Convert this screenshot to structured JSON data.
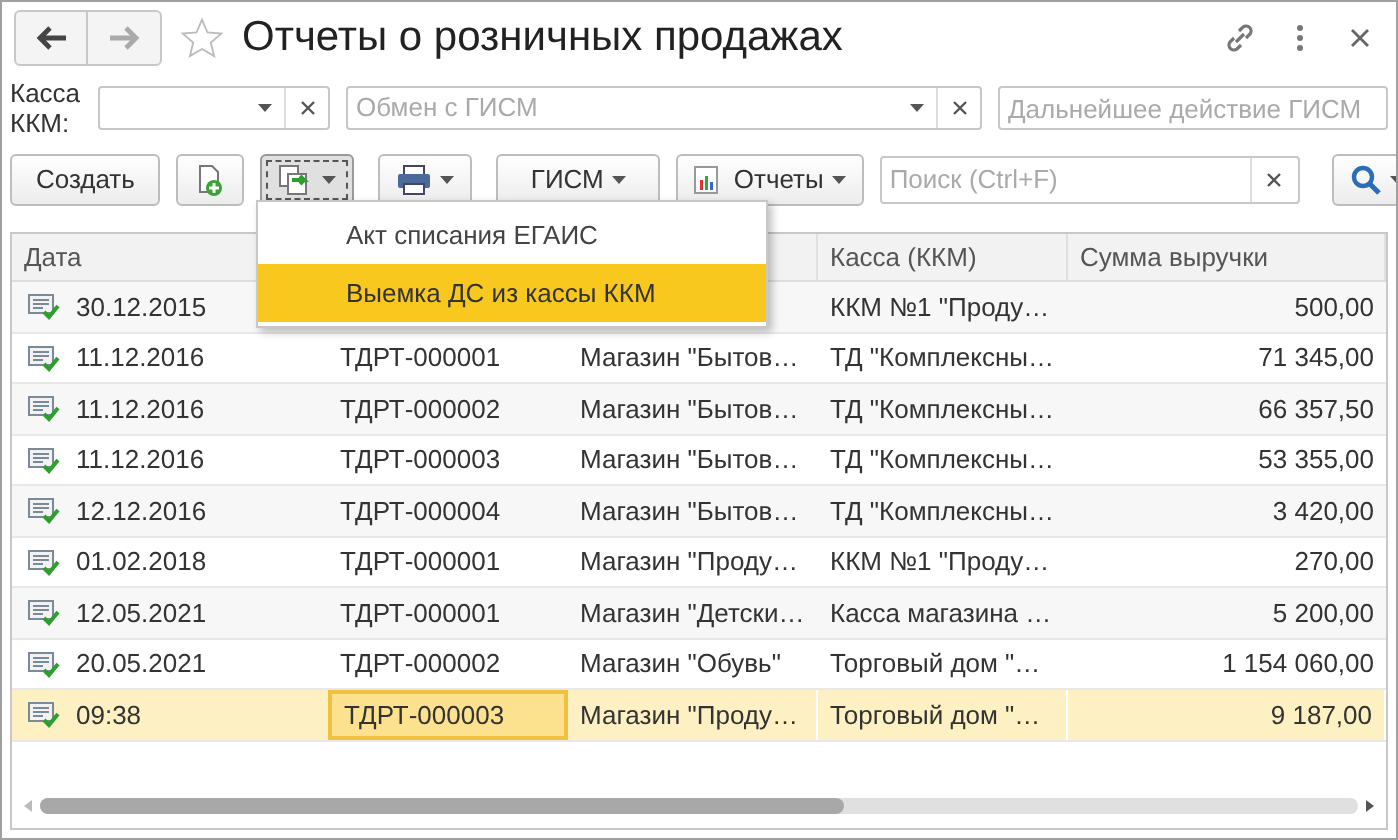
{
  "window": {
    "title": "Отчеты о розничных продажах",
    "favorite": false
  },
  "filters": {
    "register_label": "Касса ККМ:",
    "exchange_placeholder": "Обмен с ГИСМ",
    "next_action_placeholder": "Дальнейшее действие ГИСМ"
  },
  "toolbar": {
    "create": "Создать",
    "create_based_on_open": true,
    "gism": "ГИСМ",
    "reports": "Отчеты",
    "search_placeholder": "Поиск (Ctrl+F)"
  },
  "menu": [
    {
      "label": "Акт списания ЕГАИС",
      "selected": false
    },
    {
      "label": "Выемка ДС из кассы ККМ",
      "selected": true
    }
  ],
  "table": {
    "columns": [
      {
        "label": "Дата"
      },
      {},
      {},
      {
        "label": "Касса (ККМ)"
      },
      {
        "label": "Сумма выручки"
      }
    ],
    "rows": [
      {
        "date": "30.12.2015",
        "register": "ККМ №1 \"Проду…",
        "amount": "500,00",
        "selected": false
      },
      {
        "date": "11.12.2016",
        "number": "ТДРТ-000001",
        "shop": "Магазин \"Бытов…",
        "register": "ТД \"Комплексны…",
        "amount": "71 345,00",
        "selected": false
      },
      {
        "date": "11.12.2016",
        "number": "ТДРТ-000002",
        "shop": "Магазин \"Бытов…",
        "register": "ТД \"Комплексны…",
        "amount": "66 357,50",
        "selected": false
      },
      {
        "date": "11.12.2016",
        "number": "ТДРТ-000003",
        "shop": "Магазин \"Бытов…",
        "register": "ТД \"Комплексны…",
        "amount": "53 355,00",
        "selected": false
      },
      {
        "date": "12.12.2016",
        "number": "ТДРТ-000004",
        "shop": "Магазин \"Бытов…",
        "register": "ТД \"Комплексны…",
        "amount": "3 420,00",
        "selected": false
      },
      {
        "date": "01.02.2018",
        "number": "ТДРТ-000001",
        "shop": "Магазин \"Проду…",
        "register": "ККМ №1 \"Проду…",
        "amount": "270,00",
        "selected": false
      },
      {
        "date": "12.05.2021",
        "number": "ТДРТ-000001",
        "shop": "Магазин \"Детски…",
        "register": "Касса магазина …",
        "amount": "5 200,00",
        "selected": false
      },
      {
        "date": "20.05.2021",
        "number": "ТДРТ-000002",
        "shop": "Магазин \"Обувь\"",
        "register": "Торговый дом \"…",
        "amount": "1 154 060,00",
        "selected": false
      },
      {
        "date": "09:38",
        "number": "ТДРТ-000003",
        "shop": "Магазин \"Проду…",
        "register": "Торговый дом \"…",
        "amount": "9 187,00",
        "selected": true,
        "number_focused": true
      }
    ]
  }
}
